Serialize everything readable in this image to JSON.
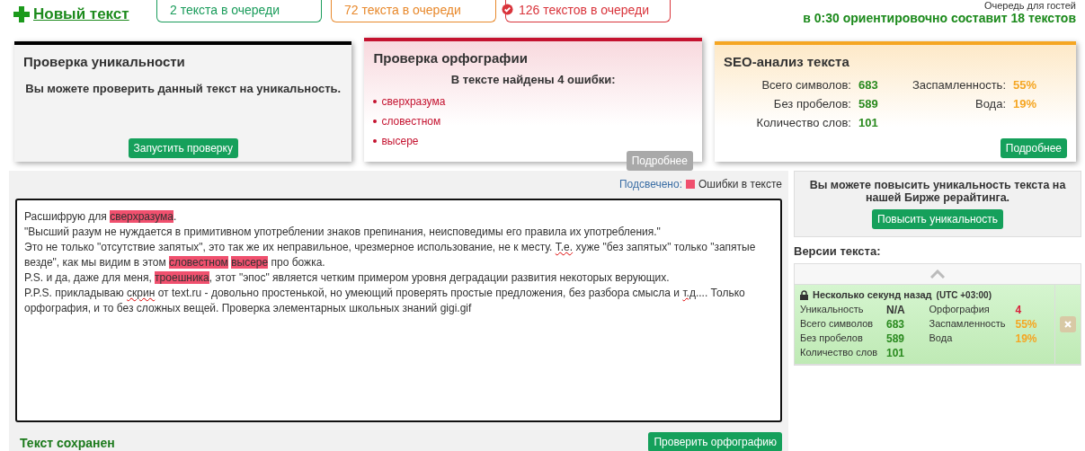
{
  "header": {
    "new_text": "Новый текст",
    "queues": [
      {
        "label": "2 текста в очереди",
        "color": "#1a9c5b",
        "icon": false
      },
      {
        "label": "72 текста в очереди",
        "color": "#e8892c",
        "icon": false
      },
      {
        "label": "126 текстов в очереди",
        "color": "#d9343b",
        "icon": true
      }
    ],
    "guest_queue_title": "Очередь для гостей",
    "guest_queue_estimate": "в 0:30 ориентировочно составит 18 текстов"
  },
  "cards": [
    {
      "kind": "uniqueness",
      "title": "Проверка уникальности",
      "message": "Вы можете проверить данный текст на уникальность.",
      "button": {
        "label": "Запустить проверку",
        "disabled": false
      }
    },
    {
      "kind": "spelling",
      "title": "Проверка орфографии",
      "summary": "В тексте найдены 4 ошибки:",
      "errors": [
        "сверхразума",
        "словестном",
        "высере"
      ],
      "button": {
        "label": "Подробнее",
        "disabled": true
      }
    },
    {
      "kind": "seo",
      "title": "SEO-анализ текста",
      "stats_left": [
        {
          "label": "Всего символов:",
          "value": "683"
        },
        {
          "label": "Без пробелов:",
          "value": "589"
        },
        {
          "label": "Количество слов:",
          "value": "101"
        }
      ],
      "stats_right": [
        {
          "label": "Заспамленность:",
          "value": "55%"
        },
        {
          "label": "Вода:",
          "value": "19%"
        }
      ],
      "button": {
        "label": "Подробнее",
        "disabled": false
      }
    }
  ],
  "editor": {
    "legend_label": "Подсвечено:",
    "legend_item": "Ошибки в тексте",
    "paragraphs": [
      [
        {
          "text": "Расшифрую для ",
          "kind": "plain"
        },
        {
          "text": "сверхразума",
          "kind": "error"
        },
        {
          "text": ".",
          "kind": "plain"
        }
      ],
      [
        {
          "text": "\"Высший разум не нуждается в примитивном употреблении знаков препинания, неисповедимы его правила их употребления.\"",
          "kind": "plain"
        }
      ],
      [
        {
          "text": "Это не только \"отсутствие запятых\", это так же их неправильное, чрезмерное использование, не к месту. ",
          "kind": "plain"
        },
        {
          "text": "Т.е.",
          "kind": "spell"
        },
        {
          "text": " хуже \"без запятых\" только \"запятые везде\", как мы видим в этом ",
          "kind": "plain"
        },
        {
          "text": "словестном",
          "kind": "error"
        },
        {
          "text": "высере",
          "kind": "error"
        },
        {
          "text": " про божка.",
          "kind": "plain"
        }
      ],
      [
        {
          "text": "P.S. и да, даже для меня, ",
          "kind": "plain"
        },
        {
          "text": "троешника",
          "kind": "error"
        },
        {
          "text": ", этот \"эпос\" является четким примером уровня деградации развития некоторых верующих.",
          "kind": "plain"
        }
      ],
      [
        {
          "text": "P.P.S. прикладываю ",
          "kind": "plain"
        },
        {
          "text": "скрин",
          "kind": "spell"
        },
        {
          "text": " от text.ru - довольно простенькой, но умеющий проверять простые предложения, без разбора смысла и ",
          "kind": "plain"
        },
        {
          "text": "т.д",
          "kind": "spell"
        },
        {
          "text": ".... Только орфография, и то без сложных вещей. Проверка элементарных школьных знаний gigi.gif",
          "kind": "plain"
        }
      ]
    ],
    "status": "Текст сохранен",
    "check_button": "Проверить орфографию"
  },
  "sidebar": {
    "promo_text": "Вы можете повысить уникальность текста на нашей Бирже рерайтинга.",
    "promo_button": "Повысить уникальность",
    "versions_title": "Версии текста:",
    "versions": [
      {
        "time": "Несколько секунд назад",
        "timezone": "(UTC +03:00)",
        "locked": true,
        "selected": true,
        "left": [
          {
            "label": "Уникальность",
            "value": "N/A",
            "color": "#333333"
          },
          {
            "label": "Всего символов",
            "value": "683",
            "color": "#2a8a1f"
          },
          {
            "label": "Без пробелов",
            "value": "589",
            "color": "#2a8a1f"
          },
          {
            "label": "Количество слов",
            "value": "101",
            "color": "#2a8a1f"
          }
        ],
        "right": [
          {
            "label": "Орфография",
            "value": "4",
            "color": "#d9203b"
          },
          {
            "label": "Заспамленность",
            "value": "55%",
            "color": "#f5a623"
          },
          {
            "label": "Вода",
            "value": "19%",
            "color": "#f5a623"
          }
        ]
      }
    ]
  }
}
